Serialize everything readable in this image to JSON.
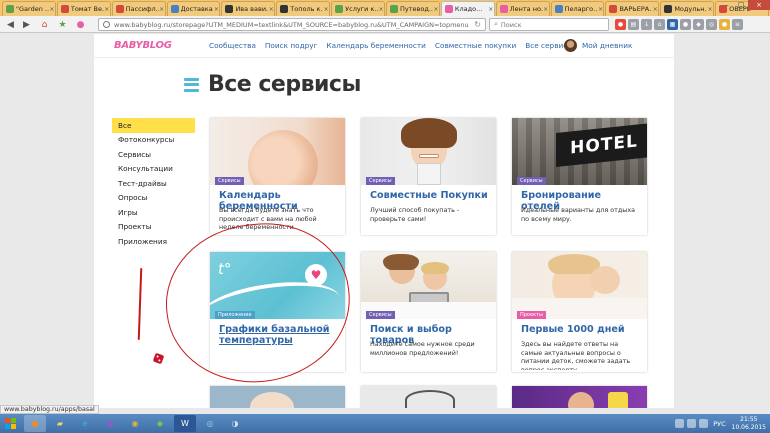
{
  "browser": {
    "tabs": [
      {
        "title": "\"Garden ...",
        "color": "#5fa14a"
      },
      {
        "title": "Томат Ве...",
        "color": "#d44a3a"
      },
      {
        "title": "Пассифл...",
        "color": "#d44a3a"
      },
      {
        "title": "Доставка...",
        "color": "#4b7fc4"
      },
      {
        "title": "Ива вави...",
        "color": "#333333"
      },
      {
        "title": "Тополь к...",
        "color": "#333333"
      },
      {
        "title": "Услуги к...",
        "color": "#59a34a"
      },
      {
        "title": "Путевод...",
        "color": "#59a34a"
      },
      {
        "title": "Кладо...",
        "color": "#e75ea7",
        "active": true
      },
      {
        "title": "Лента но...",
        "color": "#e75ea7"
      },
      {
        "title": "Пеларго...",
        "color": "#4b7fc4"
      },
      {
        "title": "ВАРЬЕРА...",
        "color": "#d44a3a"
      },
      {
        "title": "Модульн...",
        "color": "#333333"
      },
      {
        "title": "ОВЕРЕ",
        "color": "#d44a3a"
      }
    ],
    "url": "www.babyblog.ru/storepage?UTM_MEDIUM=textlink&UTM_SOURCE=babyblog.ru&UTM_CAMPAIGN=topmenu",
    "search_placeholder": "Поиск",
    "status_url": "www.babyblog.ru/apps/basal"
  },
  "site": {
    "logo": "BABYBLOG",
    "nav": [
      "Сообщества",
      "Поиск подруг",
      "Календарь беременности",
      "Совместные покупки",
      "Все сервисы"
    ],
    "user_link": "Мой дневник",
    "page_title": "Все сервисы"
  },
  "sidebar": {
    "items": [
      {
        "label": "Все",
        "active": true
      },
      {
        "label": "Фотоконкурсы"
      },
      {
        "label": "Сервисы"
      },
      {
        "label": "Консультации"
      },
      {
        "label": "Тест-драйвы"
      },
      {
        "label": "Опросы"
      },
      {
        "label": "Игры"
      },
      {
        "label": "Проекты"
      },
      {
        "label": "Приложения"
      }
    ]
  },
  "cards": [
    {
      "badge": "Сервисы",
      "title": "Календарь беременности",
      "desc": "Вы всегда будете знать что происходит с вами на любой неделе беременности"
    },
    {
      "badge": "Сервисы",
      "title": "Совместные Покупки",
      "desc": "Лучший способ покупать - проверьте сами!"
    },
    {
      "badge": "Сервисы",
      "title": "Бронирование отелей",
      "desc": "Идеальные варианты для отдыха по всему миру."
    },
    {
      "badge": "Приложение",
      "title": "Графики базальной температуры",
      "desc": ""
    },
    {
      "badge": "Сервисы",
      "title": "Поиск и выбор товаров",
      "desc": "Находите самое нужное среди миллионов предложений!"
    },
    {
      "badge": "Проекты",
      "title": "Первые 1000 дней",
      "desc": "Здесь вы найдете ответы на самые актуальные вопросы о питании деток, сможете задать вопрос эксперту."
    }
  ],
  "hotel_sign": "HOTEL",
  "taskbar": {
    "lang": "РУС",
    "time": "21:55",
    "date": "10.06.2015"
  }
}
